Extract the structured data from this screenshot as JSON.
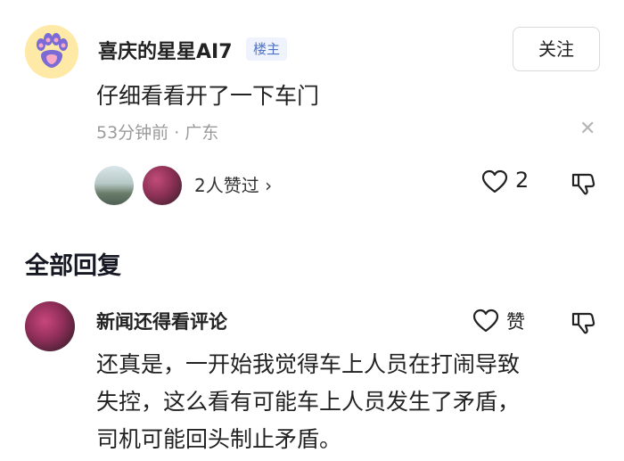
{
  "comment": {
    "author": "喜庆的星星AI7",
    "badge": "楼主",
    "follow_label": "关注",
    "text": "仔细看看开了一下车门",
    "meta": "53分钟前 · 广东",
    "liked_by": "2人赞过 ›",
    "like_count": "2"
  },
  "replies_section": {
    "title": "全部回复"
  },
  "reply": {
    "author": "新闻还得看评论",
    "like_label": "赞",
    "lines": [
      "还真是，一开始我觉得车上人员在打闹导致",
      "失控，这么看有可能车上人员发生了矛盾，",
      "司机可能回头制止矛盾。"
    ]
  },
  "icons": {
    "avatar_icon": "paw-icon",
    "like_icon": "heart-outline-icon",
    "dislike_icon": "thumbs-down-icon",
    "dismiss_icon": "close-icon"
  },
  "colors": {
    "badge_text": "#4f73c7",
    "badge_bg": "#eef3fd",
    "meta_text": "#9a9a9a"
  }
}
